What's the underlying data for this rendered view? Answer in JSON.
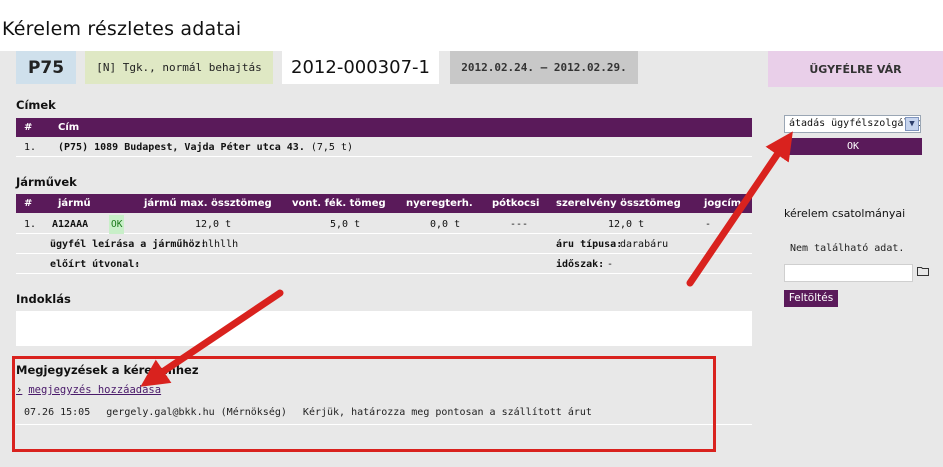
{
  "page": {
    "title": "Kérelem részletes adatai"
  },
  "header": {
    "code": "P75",
    "type_label": "[N] Tgk., normál behajtás",
    "request_number": "2012-000307-1",
    "date_range": "2012.02.24. – 2012.02.29.",
    "status": "ÜGYFÉLRE VÁR"
  },
  "addresses": {
    "heading": "Címek",
    "columns": [
      "#",
      "Cím"
    ],
    "rows": [
      {
        "index": "1.",
        "address_bold": "(P75) 1089 Budapest, Vajda Péter utca 43.",
        "extra": "(7,5 t)"
      }
    ]
  },
  "vehicles": {
    "heading": "Járművek",
    "columns": [
      "#",
      "jármű",
      "jármű max. össztömeg",
      "vont. fék. tömeg",
      "nyeregterh.",
      "pótkocsi",
      "szerelvény össztömeg",
      "jogcím"
    ],
    "rows": [
      {
        "index": "1.",
        "plate": "A12AAA",
        "badge": "OK",
        "max_weight": "12,0 t",
        "braked": "5,0 t",
        "saddle": "0,0 t",
        "trailer": "---",
        "combo": "12,0 t",
        "title": "-"
      }
    ],
    "details": {
      "desc_label": "ügyfél leírása a járműhöz:",
      "desc_value": "hlhllh",
      "cargo_label": "áru típusa:",
      "cargo_value": "darabáru",
      "route_label": "előírt útvonal:",
      "route_value": "-",
      "period_label": "időszak:",
      "period_value": "-"
    }
  },
  "justification": {
    "heading": "Indoklás"
  },
  "notes": {
    "heading": "Megjegyzések a kérelemhez",
    "add_link": "megjegyzés hozzáadása",
    "items": [
      {
        "time": "07.26 15:05",
        "author": "gergely.gal@bkk.hu (Mérnökség)",
        "text": "Kérjük, határozza meg pontosan a szállított árut"
      }
    ]
  },
  "sidebar": {
    "select_value": "átadás ügyfélszolgálatnak",
    "ok_label": "OK",
    "attachments_title": "kérelem csatolmányai",
    "attachments_empty": "Nem található adat.",
    "upload_label": "Feltöltés"
  },
  "colors": {
    "accent": "#5a1a5a",
    "annotation": "#d9221e"
  }
}
